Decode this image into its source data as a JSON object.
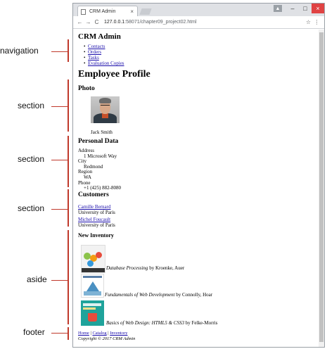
{
  "annotations": {
    "navigation": "navigation",
    "section1": "section",
    "section2": "section",
    "section3": "section",
    "aside": "aside",
    "footer": "footer"
  },
  "browser": {
    "tab_title": "CRM Admin",
    "tab_close": "×",
    "url_host": "127.0.0.1",
    "url_path": ":58071/chapter09_project02.html",
    "back": "←",
    "forward": "→",
    "reload": "C",
    "star": "☆",
    "menu": "⋮",
    "controls": {
      "user": "▲",
      "minimize": "–",
      "maximize": "□",
      "close": "×"
    }
  },
  "page": {
    "app_title": "CRM Admin",
    "nav": [
      "Contacts",
      "Orders",
      "Tasks",
      "Evaluation Copies"
    ],
    "heading": "Employee Profile",
    "photo": {
      "heading": "Photo",
      "caption": "Jack Smith"
    },
    "personal": {
      "heading": "Personal Data",
      "address_label": "Address",
      "address_value": "1 Microsoft Way",
      "city_label": "City",
      "city_value": "Redmond",
      "region_label": "Region",
      "region_value": "WA",
      "phone_label": "Phone",
      "phone_value": "+1 (425) 882-8080"
    },
    "customers": {
      "heading": "Customers",
      "items": [
        {
          "name": "Camille Bernard",
          "org": "University of Paris"
        },
        {
          "name": "Michel Foucault",
          "org": "University of Paris"
        }
      ]
    },
    "inventory": {
      "heading": "New Inventory",
      "books": [
        {
          "title": "Database Processing",
          "by": " by ",
          "author": "Kroenke, Auer"
        },
        {
          "title": "Fundamentals of Web Development",
          "by": " by ",
          "author": "Connolly, Hoar"
        },
        {
          "title": "Basics of Web Design: HTML5 & CSS3",
          "by": " by ",
          "author": "Felke-Morris"
        }
      ]
    },
    "footer": {
      "links": [
        "Home",
        "Catalog",
        "Inventory"
      ],
      "sep": " | ",
      "copyright": "Copyright © 2017 CRM Admin"
    }
  }
}
